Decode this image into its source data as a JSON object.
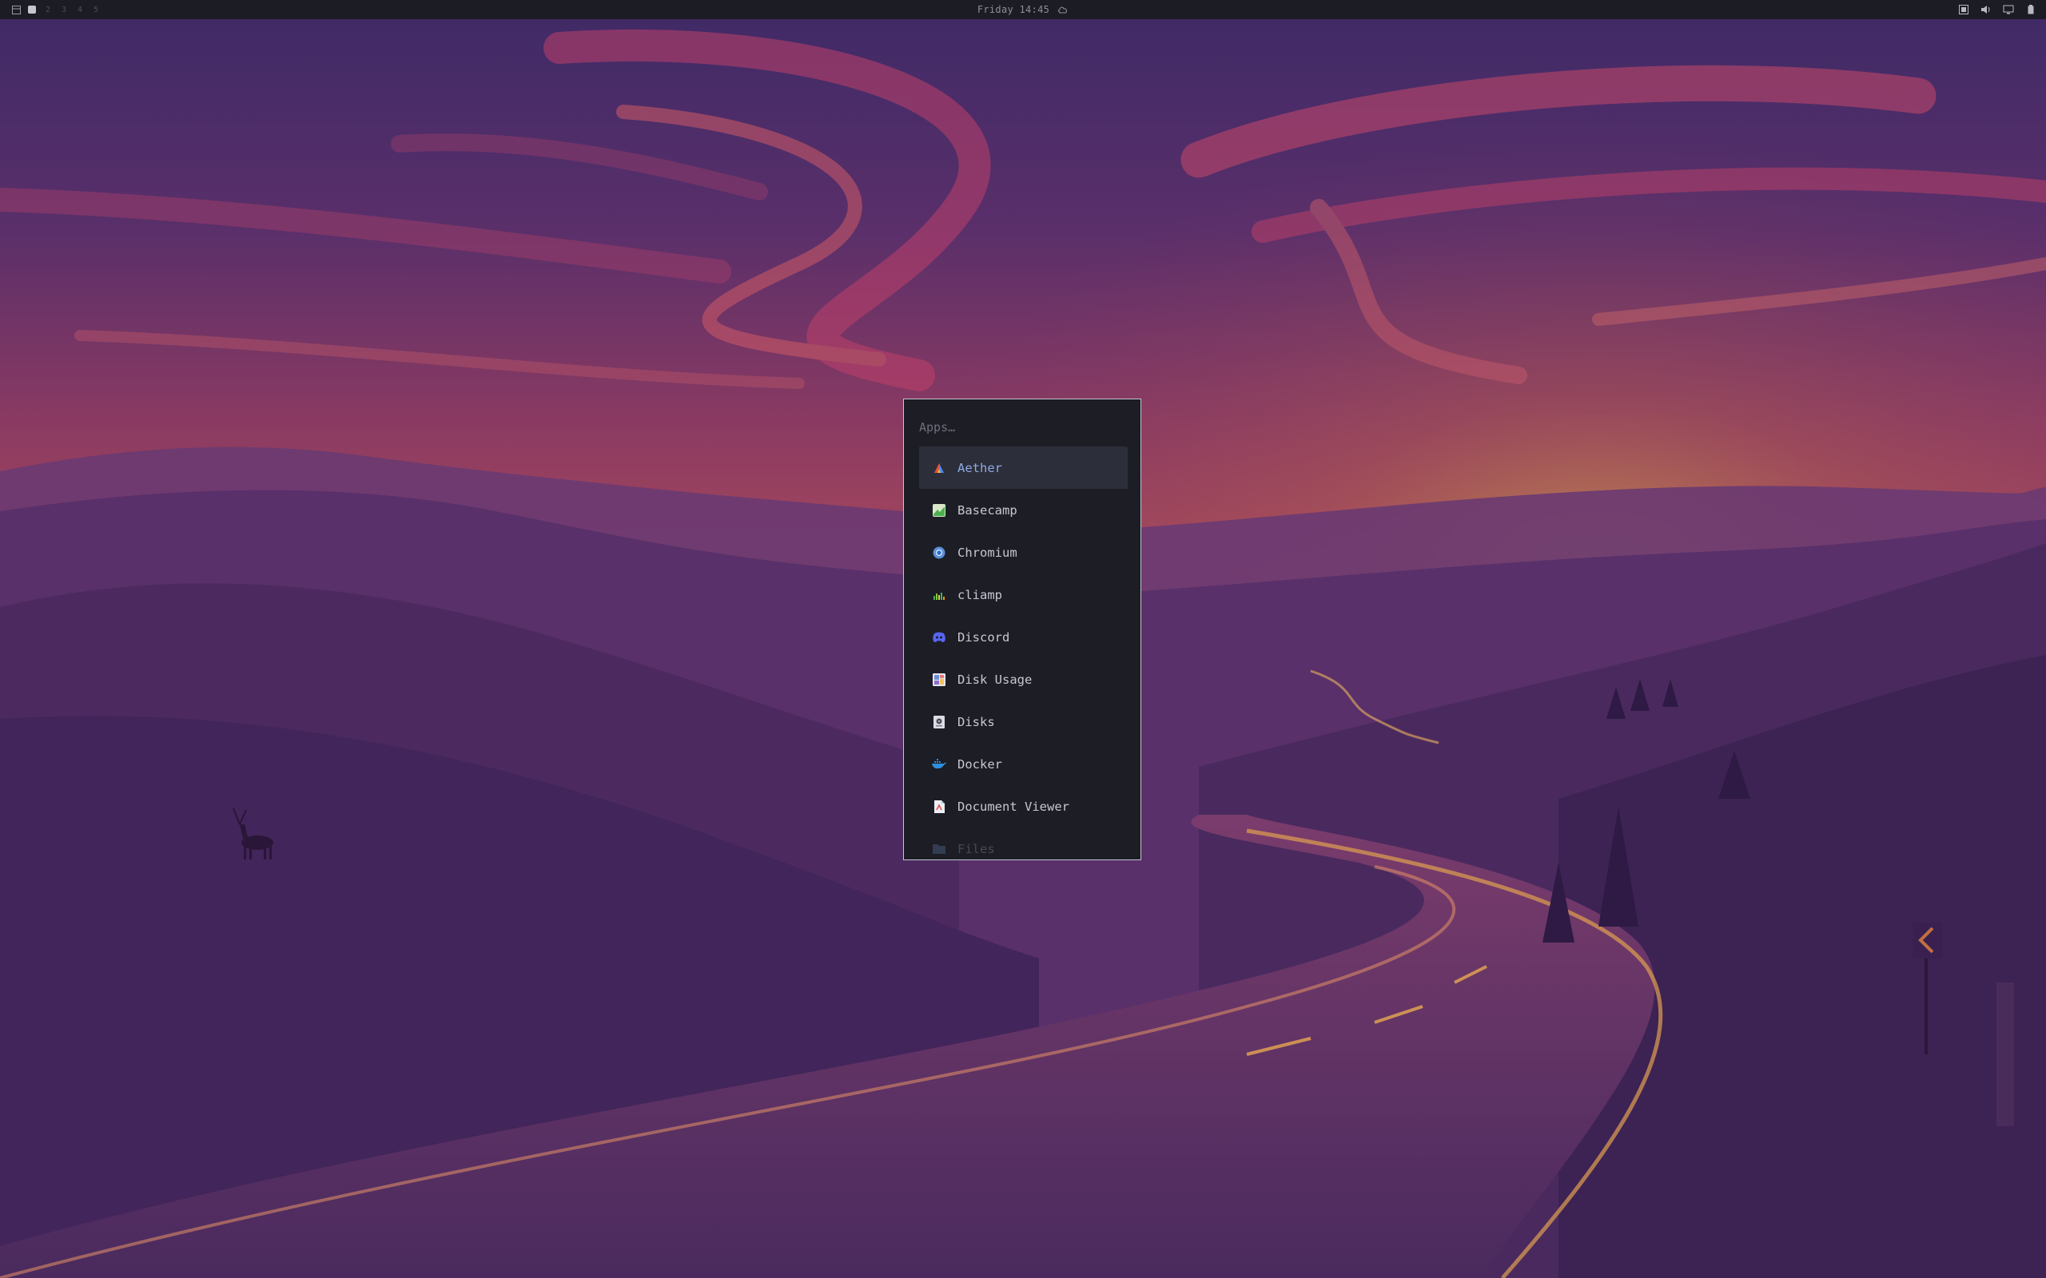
{
  "topbar": {
    "workspaces": [
      "1",
      "2",
      "3",
      "4",
      "5"
    ],
    "active_workspace": "1",
    "clock": "Friday 14:45",
    "icons": [
      "layout-icon",
      "weather-icon",
      "screenshot-icon",
      "volume-icon",
      "display-icon",
      "battery-icon"
    ]
  },
  "launcher": {
    "placeholder": "Apps…",
    "apps": [
      {
        "label": "Aether",
        "icon": "aether-icon"
      },
      {
        "label": "Basecamp",
        "icon": "basecamp-icon"
      },
      {
        "label": "Chromium",
        "icon": "chromium-icon"
      },
      {
        "label": "cliamp",
        "icon": "cliamp-icon"
      },
      {
        "label": "Discord",
        "icon": "discord-icon"
      },
      {
        "label": "Disk Usage",
        "icon": "disk-usage-icon"
      },
      {
        "label": "Disks",
        "icon": "disks-icon"
      },
      {
        "label": "Docker",
        "icon": "docker-icon"
      },
      {
        "label": "Document Viewer",
        "icon": "document-viewer-icon"
      },
      {
        "label": "Files",
        "icon": "files-icon"
      }
    ],
    "selected": "Aether"
  },
  "colors": {
    "bar_bg": "#1b1c24",
    "launcher_bg": "#1c1d25",
    "launcher_border": "#c6c6d2",
    "selected_bg": "#2c2e39",
    "selected_text": "#8fa9e6",
    "item_text": "#c6c8d2"
  }
}
